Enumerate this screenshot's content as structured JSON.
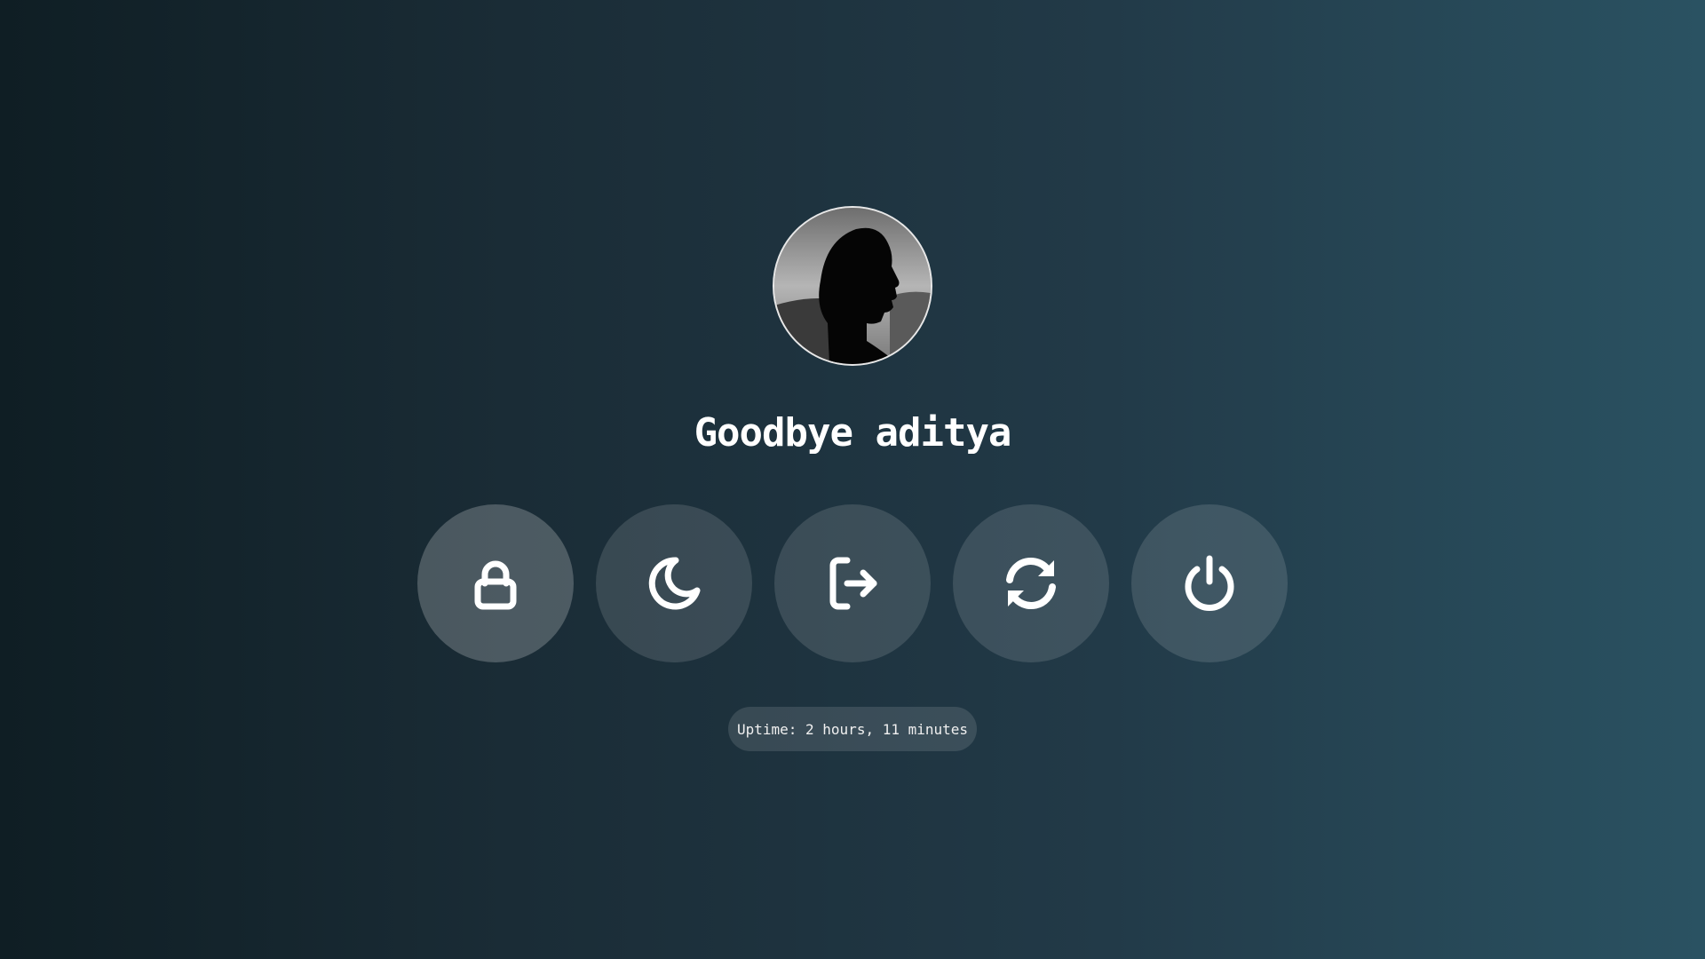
{
  "greeting": "Goodbye aditya",
  "avatar": {
    "icon": "user-silhouette-avatar"
  },
  "actions": [
    {
      "name": "lock",
      "icon": "lock-icon",
      "active": true
    },
    {
      "name": "sleep",
      "icon": "moon-icon",
      "active": false
    },
    {
      "name": "logout",
      "icon": "logout-icon",
      "active": false
    },
    {
      "name": "reboot",
      "icon": "refresh-icon",
      "active": false
    },
    {
      "name": "shutdown",
      "icon": "power-icon",
      "active": false
    }
  ],
  "uptime": "Uptime: 2 hours, 11 minutes"
}
